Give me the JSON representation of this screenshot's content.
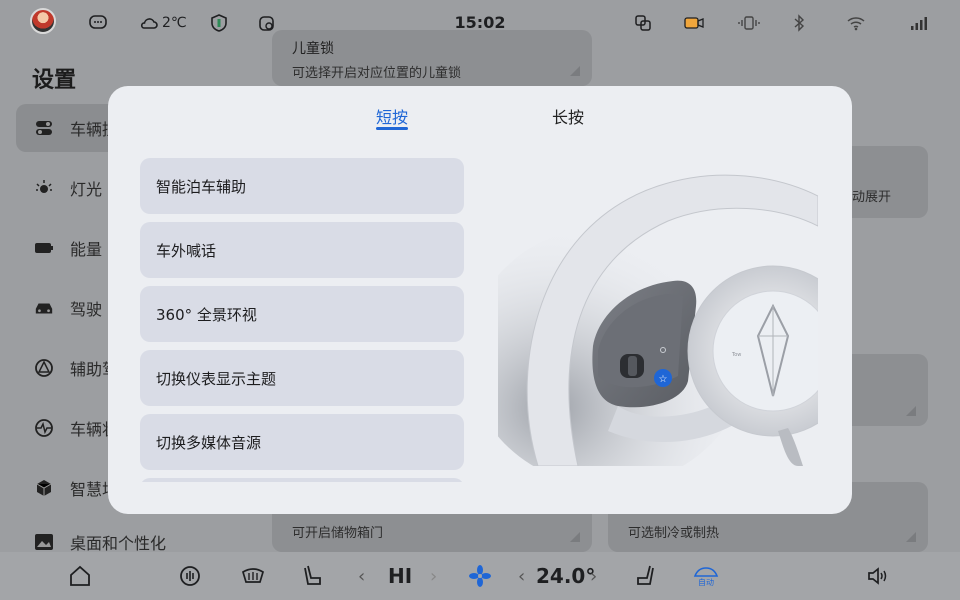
{
  "status_bar": {
    "weather_temp": "2℃",
    "time": "15:02"
  },
  "settings": {
    "title": "设置",
    "sidebar": [
      {
        "label": "车辆控",
        "icon": "toggle-icon",
        "active": true
      },
      {
        "label": "灯光",
        "icon": "light-icon",
        "active": false
      },
      {
        "label": "能量",
        "icon": "battery-icon",
        "active": false
      },
      {
        "label": "驾驶",
        "icon": "car-icon",
        "active": false
      },
      {
        "label": "辅助驾",
        "icon": "assist-icon",
        "active": false
      },
      {
        "label": "车辆状",
        "icon": "vehicle-status-icon",
        "active": false
      },
      {
        "label": "智慧场",
        "icon": "cube-icon",
        "active": false
      },
      {
        "label": "桌面和个性化",
        "icon": "image-icon",
        "active": false
      }
    ],
    "cards": {
      "child_lock_title": "儿童锁",
      "child_lock_desc": "可选择开启对应位置的儿童锁",
      "auto_expand_desc": "动展开",
      "storage_desc": "可开启储物箱门",
      "fridge_desc": "可选制冷或制热"
    }
  },
  "modal": {
    "tabs": [
      {
        "label": "短按",
        "active": true
      },
      {
        "label": "长按",
        "active": false
      }
    ],
    "options": [
      "智能泊车辅助",
      "车外喊话",
      "360° 全景环视",
      "切换仪表显示主题",
      "切换多媒体音源"
    ]
  },
  "dock": {
    "fan_level": "HI",
    "temperature": "24.0°",
    "auto_label": "自动"
  },
  "colors": {
    "accent": "#1f66d6",
    "modal_bg": "#eceef2",
    "option_bg": "#d9dce6"
  }
}
